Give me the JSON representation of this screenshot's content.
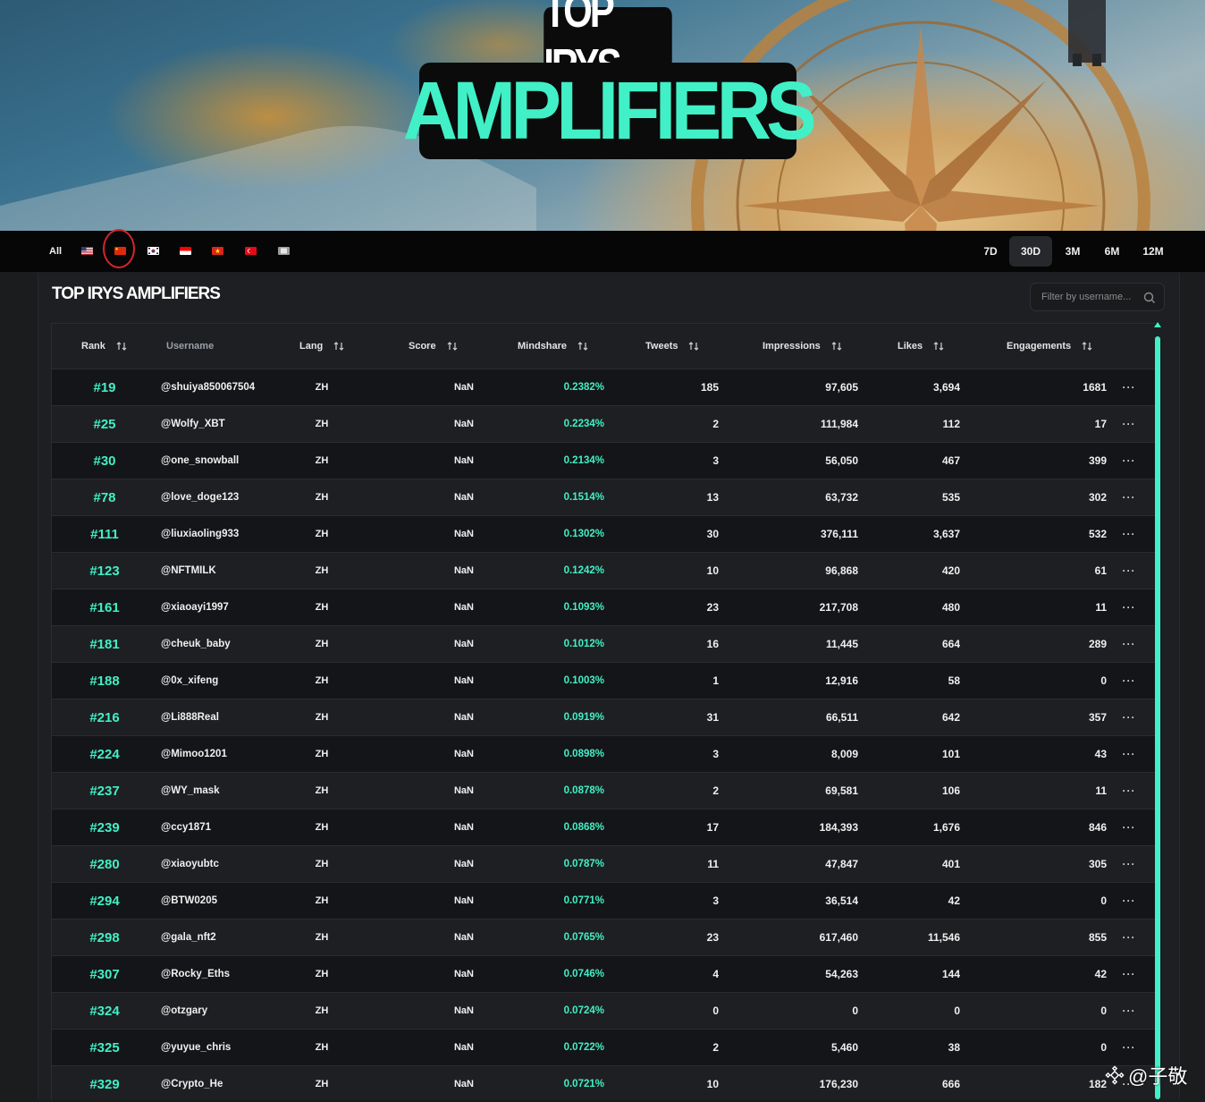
{
  "hero": {
    "title_top": "TOP IRYS",
    "title_main": "AMPLIFIERS"
  },
  "filters": {
    "all_label": "All",
    "flags": [
      {
        "name": "us-flag-icon",
        "colors": [
          "#b22234",
          "#ffffff",
          "#3c3b6e"
        ]
      },
      {
        "name": "china-flag-icon",
        "colors": [
          "#de2910",
          "#ffde00"
        ]
      },
      {
        "name": "korea-flag-icon",
        "colors": [
          "#ffffff",
          "#cd2e3a",
          "#0047a0"
        ]
      },
      {
        "name": "indonesia-flag-icon",
        "colors": [
          "#ff0000",
          "#ffffff"
        ]
      },
      {
        "name": "vietnam-flag-icon",
        "colors": [
          "#da251d",
          "#ffff00"
        ]
      },
      {
        "name": "turkey-flag-icon",
        "colors": [
          "#e30a17",
          "#ffffff"
        ]
      },
      {
        "name": "other-flag-icon",
        "colors": [
          "#9a9a9a",
          "#e6e6e6"
        ]
      }
    ],
    "selected_flag": "china-flag-icon",
    "periods": [
      "7D",
      "30D",
      "3M",
      "6M",
      "12M"
    ],
    "active_period": "30D"
  },
  "section": {
    "title": "TOP IRYS AMPLIFIERS",
    "search_placeholder": "Filter by username..."
  },
  "table": {
    "headers": {
      "rank": "Rank",
      "username": "Username",
      "lang": "Lang",
      "score": "Score",
      "mindshare": "Mindshare",
      "tweets": "Tweets",
      "impressions": "Impressions",
      "likes": "Likes",
      "engagements": "Engagements"
    },
    "more_label": "···",
    "rows": [
      {
        "rank": "#19",
        "username": "@shuiya850067504",
        "lang": "ZH",
        "score": "NaN",
        "mindshare": "0.2382%",
        "tweets": "185",
        "impressions": "97,605",
        "likes": "3,694",
        "engagements": "1681"
      },
      {
        "rank": "#25",
        "username": "@Wolfy_XBT",
        "lang": "ZH",
        "score": "NaN",
        "mindshare": "0.2234%",
        "tweets": "2",
        "impressions": "111,984",
        "likes": "112",
        "engagements": "17"
      },
      {
        "rank": "#30",
        "username": "@one_snowball",
        "lang": "ZH",
        "score": "NaN",
        "mindshare": "0.2134%",
        "tweets": "3",
        "impressions": "56,050",
        "likes": "467",
        "engagements": "399"
      },
      {
        "rank": "#78",
        "username": "@love_doge123",
        "lang": "ZH",
        "score": "NaN",
        "mindshare": "0.1514%",
        "tweets": "13",
        "impressions": "63,732",
        "likes": "535",
        "engagements": "302"
      },
      {
        "rank": "#111",
        "username": "@liuxiaoling933",
        "lang": "ZH",
        "score": "NaN",
        "mindshare": "0.1302%",
        "tweets": "30",
        "impressions": "376,111",
        "likes": "3,637",
        "engagements": "532"
      },
      {
        "rank": "#123",
        "username": "@NFTMILK",
        "lang": "ZH",
        "score": "NaN",
        "mindshare": "0.1242%",
        "tweets": "10",
        "impressions": "96,868",
        "likes": "420",
        "engagements": "61"
      },
      {
        "rank": "#161",
        "username": "@xiaoayi1997",
        "lang": "ZH",
        "score": "NaN",
        "mindshare": "0.1093%",
        "tweets": "23",
        "impressions": "217,708",
        "likes": "480",
        "engagements": "11"
      },
      {
        "rank": "#181",
        "username": "@cheuk_baby",
        "lang": "ZH",
        "score": "NaN",
        "mindshare": "0.1012%",
        "tweets": "16",
        "impressions": "11,445",
        "likes": "664",
        "engagements": "289"
      },
      {
        "rank": "#188",
        "username": "@0x_xifeng",
        "lang": "ZH",
        "score": "NaN",
        "mindshare": "0.1003%",
        "tweets": "1",
        "impressions": "12,916",
        "likes": "58",
        "engagements": "0"
      },
      {
        "rank": "#216",
        "username": "@Li888Real",
        "lang": "ZH",
        "score": "NaN",
        "mindshare": "0.0919%",
        "tweets": "31",
        "impressions": "66,511",
        "likes": "642",
        "engagements": "357"
      },
      {
        "rank": "#224",
        "username": "@Mimoo1201",
        "lang": "ZH",
        "score": "NaN",
        "mindshare": "0.0898%",
        "tweets": "3",
        "impressions": "8,009",
        "likes": "101",
        "engagements": "43"
      },
      {
        "rank": "#237",
        "username": "@WY_mask",
        "lang": "ZH",
        "score": "NaN",
        "mindshare": "0.0878%",
        "tweets": "2",
        "impressions": "69,581",
        "likes": "106",
        "engagements": "11"
      },
      {
        "rank": "#239",
        "username": "@ccy1871",
        "lang": "ZH",
        "score": "NaN",
        "mindshare": "0.0868%",
        "tweets": "17",
        "impressions": "184,393",
        "likes": "1,676",
        "engagements": "846"
      },
      {
        "rank": "#280",
        "username": "@xiaoyubtc",
        "lang": "ZH",
        "score": "NaN",
        "mindshare": "0.0787%",
        "tweets": "11",
        "impressions": "47,847",
        "likes": "401",
        "engagements": "305"
      },
      {
        "rank": "#294",
        "username": "@BTW0205",
        "lang": "ZH",
        "score": "NaN",
        "mindshare": "0.0771%",
        "tweets": "3",
        "impressions": "36,514",
        "likes": "42",
        "engagements": "0"
      },
      {
        "rank": "#298",
        "username": "@gala_nft2",
        "lang": "ZH",
        "score": "NaN",
        "mindshare": "0.0765%",
        "tweets": "23",
        "impressions": "617,460",
        "likes": "11,546",
        "engagements": "855"
      },
      {
        "rank": "#307",
        "username": "@Rocky_Eths",
        "lang": "ZH",
        "score": "NaN",
        "mindshare": "0.0746%",
        "tweets": "4",
        "impressions": "54,263",
        "likes": "144",
        "engagements": "42"
      },
      {
        "rank": "#324",
        "username": "@otzgary",
        "lang": "ZH",
        "score": "NaN",
        "mindshare": "0.0724%",
        "tweets": "0",
        "impressions": "0",
        "likes": "0",
        "engagements": "0"
      },
      {
        "rank": "#325",
        "username": "@yuyue_chris",
        "lang": "ZH",
        "score": "NaN",
        "mindshare": "0.0722%",
        "tweets": "2",
        "impressions": "5,460",
        "likes": "38",
        "engagements": "0"
      },
      {
        "rank": "#329",
        "username": "@Crypto_He",
        "lang": "ZH",
        "score": "NaN",
        "mindshare": "0.0721%",
        "tweets": "10",
        "impressions": "176,230",
        "likes": "666",
        "engagements": "182"
      }
    ]
  },
  "watermark": {
    "text": "@子敬"
  },
  "colors": {
    "accent": "#41f0c6",
    "background": "#1b1c1e",
    "bar": "#060606",
    "highlight_circle": "#d3252a"
  }
}
